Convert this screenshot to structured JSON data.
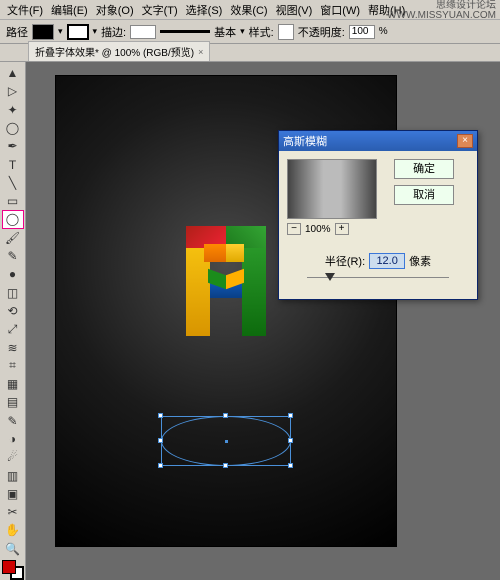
{
  "watermark": {
    "line1": "思缘设计论坛",
    "line2": "WWW.MISSYUAN.COM"
  },
  "menu": {
    "file": "文件(F)",
    "edit": "编辑(E)",
    "object": "对象(O)",
    "type": "文字(T)",
    "select": "选择(S)",
    "effect": "效果(C)",
    "view": "视图(V)",
    "window": "窗口(W)",
    "help": "帮助(H)"
  },
  "optbar": {
    "label_path": "路径",
    "label_stroke": "描边:",
    "stroke_pt": "",
    "label_basic": "基本",
    "label_style": "样式:",
    "label_opacity": "不透明度:",
    "opacity_val": "100"
  },
  "tab": {
    "title": "折叠字体效果* @ 100% (RGB/预览)"
  },
  "dialog": {
    "title": "高斯模糊",
    "ok": "确定",
    "cancel": "取消",
    "zoom": "100%",
    "radius_label": "半径(R):",
    "radius_value": "12.0",
    "radius_unit": "像素"
  },
  "icons": {
    "selection": "▲",
    "direct": "▷",
    "wand": "✦",
    "lasso": "◯",
    "pen": "✒",
    "type": "T",
    "line": "╲",
    "rect": "▭",
    "brush": "🖌",
    "pencil": "✎",
    "blob": "●",
    "eraser": "◫",
    "rotate": "⟲",
    "scale": "⤢",
    "warp": "≋",
    "fws": "⌗",
    "mesh": "▦",
    "gradient": "▤",
    "eyedrop": "✎",
    "blend": "◑",
    "symbol": "☄",
    "graph": "▥",
    "artb": "▣",
    "slice": "✂",
    "hand": "✋",
    "zoom": "🔍"
  }
}
